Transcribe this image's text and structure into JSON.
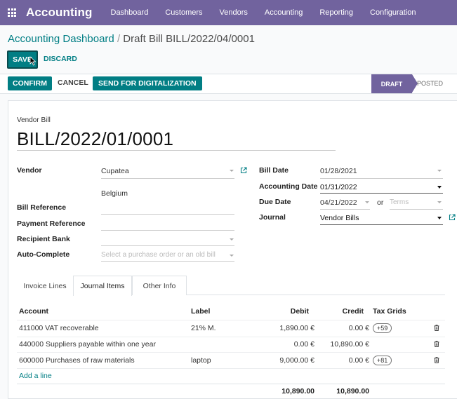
{
  "navbar": {
    "app_title": "Accounting",
    "menu": [
      "Dashboard",
      "Customers",
      "Vendors",
      "Accounting",
      "Reporting",
      "Configuration"
    ]
  },
  "breadcrumb": {
    "parent": "Accounting Dashboard",
    "separator": "/",
    "current": "Draft Bill BILL/2022/04/0001"
  },
  "actions": {
    "save": "SAVE",
    "discard": "DISCARD"
  },
  "statusbar": {
    "buttons": {
      "confirm": "CONFIRM",
      "cancel": "CANCEL",
      "digitalize": "SEND FOR DIGITALIZATION"
    },
    "stages": {
      "draft": "DRAFT",
      "posted": "POSTED"
    },
    "active_stage": "DRAFT"
  },
  "form": {
    "doc_type": "Vendor Bill",
    "name": "BILL/2022/01/0001",
    "vendor": {
      "label": "Vendor",
      "value": "Cupatea",
      "address": "Belgium"
    },
    "bill_reference": {
      "label": "Bill Reference",
      "value": ""
    },
    "payment_reference": {
      "label": "Payment Reference",
      "value": ""
    },
    "recipient_bank": {
      "label": "Recipient Bank",
      "value": ""
    },
    "auto_complete": {
      "label": "Auto-Complete",
      "placeholder": "Select a purchase order or an old bill"
    },
    "bill_date": {
      "label": "Bill Date",
      "value": "01/28/2021"
    },
    "accounting_date": {
      "label": "Accounting Date",
      "value": "01/31/2022"
    },
    "due_date": {
      "label": "Due Date",
      "value": "04/21/2022",
      "or": "or",
      "terms_placeholder": "Terms"
    },
    "journal": {
      "label": "Journal",
      "value": "Vendor Bills"
    }
  },
  "tabs": [
    "Invoice Lines",
    "Journal Items",
    "Other Info"
  ],
  "active_tab": "Journal Items",
  "table": {
    "headers": {
      "account": "Account",
      "label": "Label",
      "debit": "Debit",
      "credit": "Credit",
      "tax_grids": "Tax Grids"
    },
    "rows": [
      {
        "account": "411000 VAT recoverable",
        "label": "21% M.",
        "debit": "1,890.00 €",
        "credit": "0.00 €",
        "tax_grid": "+59"
      },
      {
        "account": "440000 Suppliers payable within one year",
        "label": "",
        "debit": "0.00 €",
        "credit": "10,890.00 €",
        "tax_grid": ""
      },
      {
        "account": "600000 Purchases of raw materials",
        "label": "laptop",
        "debit": "9,000.00 €",
        "credit": "0.00 €",
        "tax_grid": "+81"
      }
    ],
    "add_line": "Add a line",
    "totals": {
      "debit": "10,890.00",
      "credit": "10,890.00"
    }
  },
  "colors": {
    "navbar": "#71639e",
    "primary": "#017e84"
  },
  "icons": [
    "apps-grid-icon",
    "external-link-icon",
    "trash-icon",
    "cursor-pointer-icon"
  ]
}
